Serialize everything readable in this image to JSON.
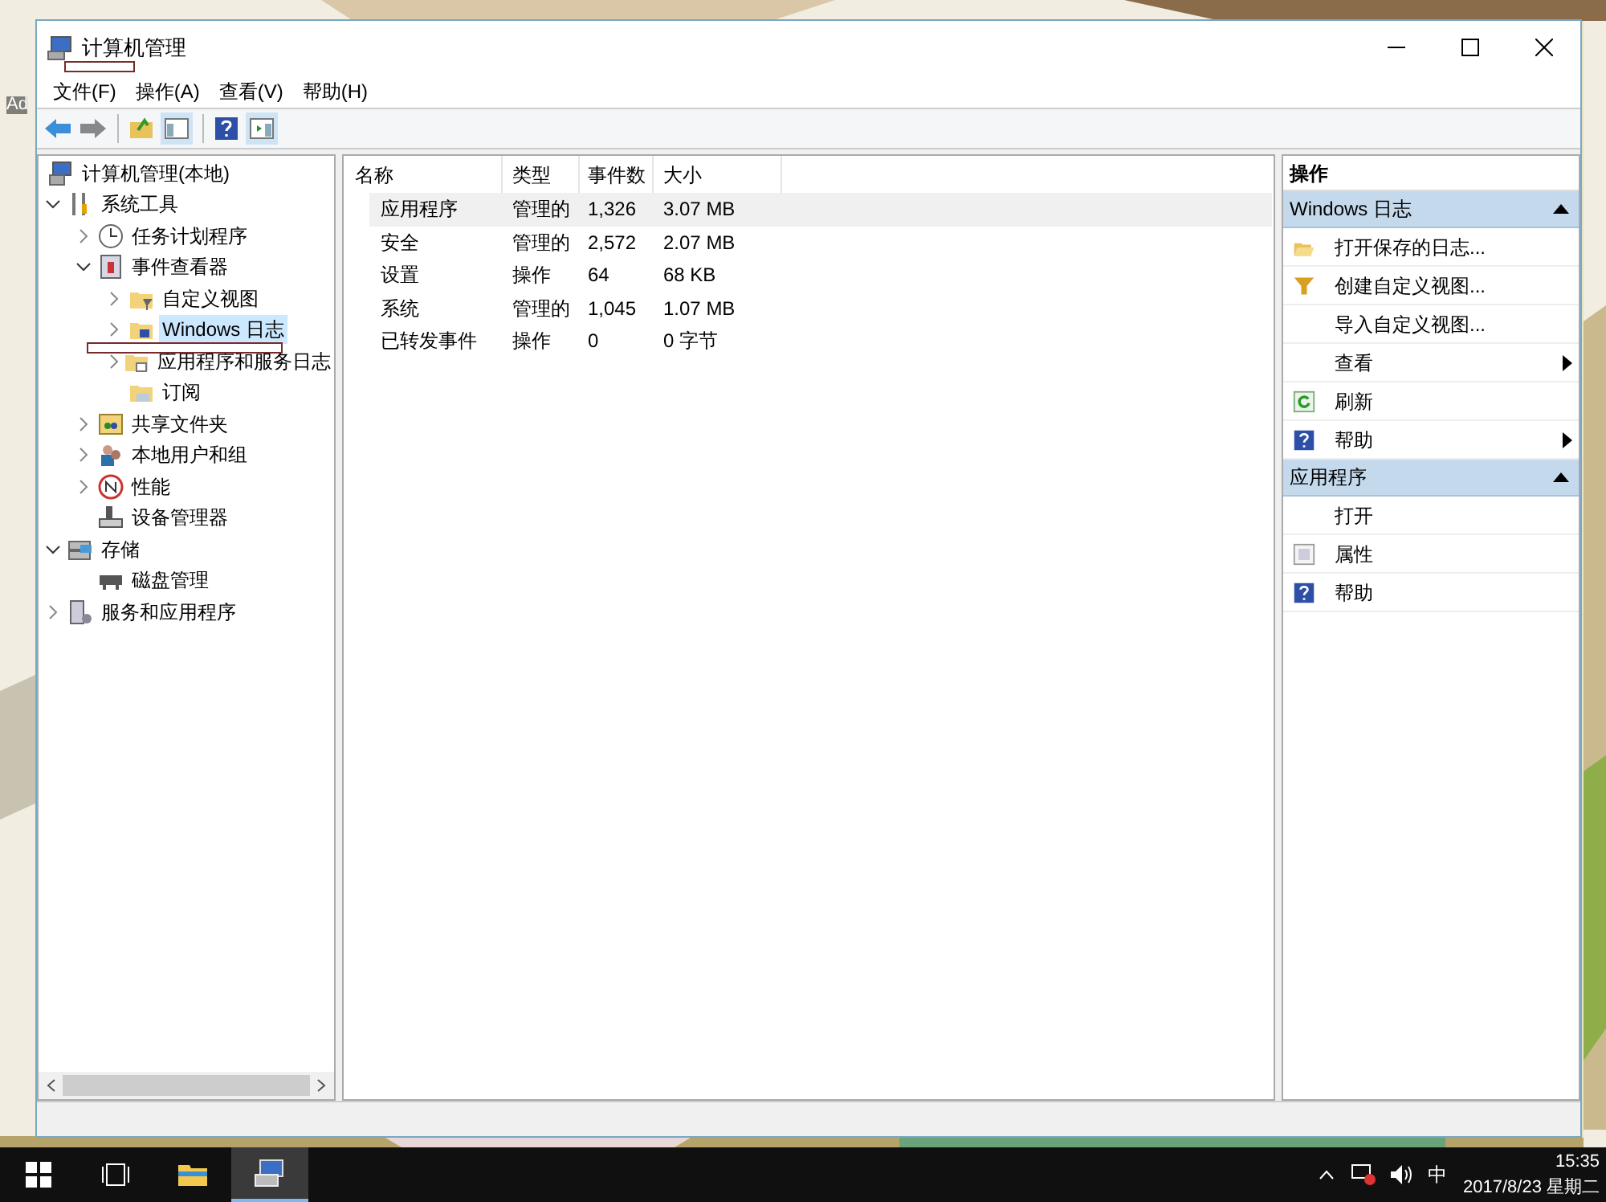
{
  "desktop": {
    "icon_label": "Ad"
  },
  "window": {
    "title": "计算机管理"
  },
  "menu": [
    "文件(F)",
    "操作(A)",
    "查看(V)",
    "帮助(H)"
  ],
  "tree": [
    {
      "label": "计算机管理(本地)",
      "selected": false,
      "children": [
        {
          "label": "系统工具",
          "expanded": true,
          "selected": false,
          "children": [
            {
              "label": "任务计划程序",
              "expanded": false,
              "selected": false
            },
            {
              "label": "事件查看器",
              "expanded": true,
              "selected": false,
              "children": [
                {
                  "label": "自定义视图",
                  "expanded": false,
                  "selected": false
                },
                {
                  "label": "Windows 日志",
                  "expanded": false,
                  "selected": true
                },
                {
                  "label": "应用程序和服务日志",
                  "expanded": false,
                  "selected": false
                },
                {
                  "label": "订阅",
                  "selected": false
                }
              ]
            },
            {
              "label": "共享文件夹",
              "expanded": false,
              "selected": false
            },
            {
              "label": "本地用户和组",
              "expanded": false,
              "selected": false
            },
            {
              "label": "性能",
              "expanded": false,
              "selected": false
            },
            {
              "label": "设备管理器",
              "selected": false
            }
          ]
        },
        {
          "label": "存储",
          "expanded": true,
          "selected": false,
          "children": [
            {
              "label": "磁盘管理",
              "selected": false
            }
          ]
        },
        {
          "label": "服务和应用程序",
          "expanded": false,
          "selected": false
        }
      ]
    }
  ],
  "table": {
    "columns": [
      "名称",
      "类型",
      "事件数",
      "大小"
    ],
    "rows": [
      {
        "cells": [
          "应用程序",
          "管理的",
          "1,326",
          "3.07 MB"
        ],
        "selected": true
      },
      {
        "cells": [
          "安全",
          "管理的",
          "2,572",
          "2.07 MB"
        ],
        "selected": false
      },
      {
        "cells": [
          "设置",
          "操作",
          "64",
          "68 KB"
        ],
        "selected": false
      },
      {
        "cells": [
          "系统",
          "管理的",
          "1,045",
          "1.07 MB"
        ],
        "selected": false
      },
      {
        "cells": [
          "已转发事件",
          "操作",
          "0",
          "0 字节"
        ],
        "selected": false
      }
    ]
  },
  "actions": {
    "title": "操作",
    "sections": [
      {
        "title": "Windows 日志",
        "expanded": true,
        "items": [
          {
            "label": "打开保存的日志...",
            "submenu": false
          },
          {
            "label": "创建自定义视图...",
            "submenu": false
          },
          {
            "label": "导入自定义视图...",
            "submenu": false
          },
          {
            "label": "查看",
            "submenu": true
          },
          {
            "label": "刷新",
            "submenu": false
          },
          {
            "label": "帮助",
            "submenu": true
          }
        ]
      },
      {
        "title": "应用程序",
        "expanded": true,
        "items": [
          {
            "label": "打开",
            "submenu": false
          },
          {
            "label": "属性",
            "submenu": false
          },
          {
            "label": "帮助",
            "submenu": false
          }
        ]
      }
    ]
  },
  "taskbar": {
    "apps": [
      {
        "selected": false
      },
      {
        "selected": true
      }
    ],
    "ime": "中",
    "time": "15:35",
    "date": "2017/8/23 星期二"
  }
}
